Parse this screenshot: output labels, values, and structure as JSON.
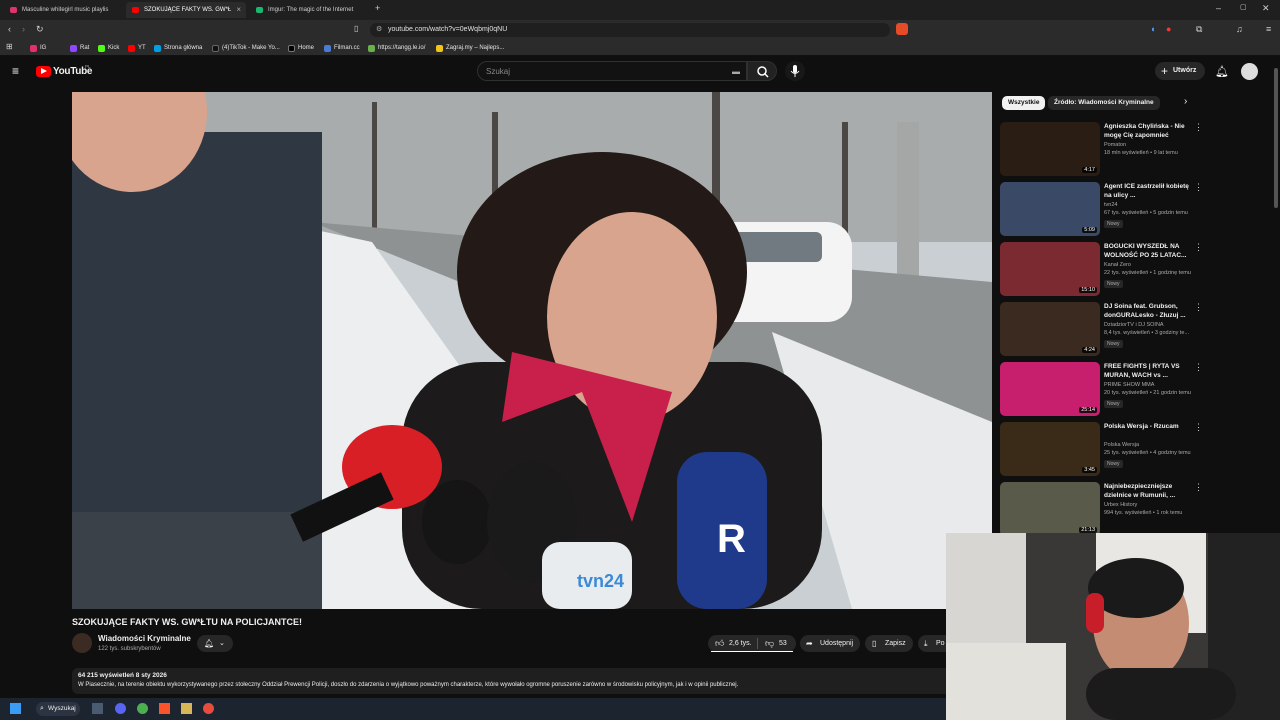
{
  "browser": {
    "tabs": [
      {
        "label": "Masculine whitegirl music playlis",
        "active": false
      },
      {
        "label": "SZOKUJĄCE FAKTY WS. GW*Ł",
        "active": true
      },
      {
        "label": "Imgur: The magic of the Internet",
        "active": false
      }
    ],
    "url": "youtube.com/watch?v=0eWqbmj0qNU",
    "bookmarks": [
      "IG",
      "Rat",
      "Kick",
      "YT",
      "Strona główna",
      "(4)TikTok - Make Yo...",
      "Home",
      "Filman.cc",
      "https://tangg.le.io/",
      "Zagraj.my – Najleps..."
    ]
  },
  "youtube": {
    "logo_text": "YouTube",
    "region": "PL",
    "search_placeholder": "Szukaj",
    "create_label": "Utwórz"
  },
  "video": {
    "title": "SZOKUJĄCE FAKTY WS. GW*ŁTU NA POLICJANTCE!",
    "channel": "Wiadomości Kryminalne",
    "subscribers": "122 tys. subskrybentów",
    "likes": "2,6 tys.",
    "dislikes": "53",
    "share_label": "Udostępnij",
    "save_label": "Zapisz",
    "download_label": "Po",
    "views_date": "64 215 wyświetleń  8 sty 2026",
    "description": "W Piasecznie, na terenie obiektu wykorzystywanego przez stołeczny Oddział Prewencji Policji, doszło do zdarzenia o wyjątkowo poważnym charakterze, które wywołało ogromne poruszenie zarówno w środowisku policyjnym, jak i w opinii publicznej."
  },
  "chips": [
    "Wszystkie",
    "Źródło: Wiadomości Kryminalne"
  ],
  "recommendations": [
    {
      "title": "Agnieszka Chylińska - Nie mogę Cię zapomnieć",
      "channel": "Pomaton",
      "views": "18 mln wyświetleń • 9 lat temu",
      "duration": "4:17",
      "new": "",
      "color": "#2a1d14"
    },
    {
      "title": "Agent ICE zastrzelił kobietę na ulicy ...",
      "channel": "tvn24",
      "views": "67 tys. wyświetleń • 5 godzin temu",
      "duration": "5:09",
      "new": "Nowy",
      "color": "#3a4a66"
    },
    {
      "title": "BOGUCKI WYSZEDŁ NA WOLNOŚĆ PO 25 LATAC...",
      "channel": "Kanał Zero",
      "views": "22 tys. wyświetleń • 1 godzinę temu",
      "duration": "15:10",
      "new": "Nowy",
      "color": "#7a2a30"
    },
    {
      "title": "DJ Soina feat. Grubson, donGURALesko - Złuzuj ...",
      "channel": "DziadziorTV i DJ SOINA",
      "views": "8,4 tys. wyświetleń • 3 godziny te...",
      "duration": "4:24",
      "new": "Nowy",
      "color": "#3a2a20"
    },
    {
      "title": "FREE FIGHTS | RYTA VS MURAN, WACH vs ...",
      "channel": "PRIME SHOW MMA",
      "views": "20 tys. wyświetleń • 21 godzin temu",
      "duration": "25:14",
      "new": "Nowy",
      "color": "#c81e6e"
    },
    {
      "title": "Polska Wersja - Rzucam",
      "channel": "Polska Wersja",
      "views": "25 tys. wyświetleń • 4 godziny temu",
      "duration": "3:45",
      "new": "Nowy",
      "color": "#3a2a18"
    },
    {
      "title": "Najniebezpieczniejsze dzielnice w Rumunii, ...",
      "channel": "Urbex History",
      "views": "994 tys. wyświetleń • 1 rok temu",
      "duration": "21:13",
      "new": "",
      "color": "#5a5a4a"
    }
  ],
  "taskbar": {
    "search_label": "Wyszukaj"
  }
}
